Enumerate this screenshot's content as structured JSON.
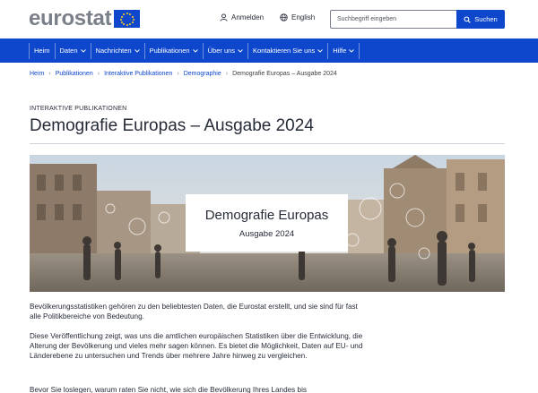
{
  "header": {
    "logo_text": "eurostat",
    "login_label": "Anmelden",
    "language_label": "English",
    "search_placeholder": "Suchbegriff eingeben",
    "search_button_label": "Suchen"
  },
  "nav": {
    "items": [
      {
        "label": "Heim"
      },
      {
        "label": "Daten"
      },
      {
        "label": "Nachrichten"
      },
      {
        "label": "Publikationen"
      },
      {
        "label": "Über uns"
      },
      {
        "label": "Kontaktieren Sie uns"
      },
      {
        "label": "Hilfe"
      }
    ]
  },
  "breadcrumb": {
    "items": [
      "Heim",
      "Publikationen",
      "Interaktive Publikationen",
      "Demographie"
    ],
    "current": "Demografie Europas – Ausgabe 2024"
  },
  "page": {
    "kicker": "INTERAKTIVE PUBLIKATIONEN",
    "title": "Demografie Europas – Ausgabe 2024"
  },
  "hero": {
    "title": "Demografie Europas",
    "subtitle": "Ausgabe 2024"
  },
  "content": {
    "paragraphs": [
      "Bevölkerungsstatistiken gehören zu den beliebtesten Daten, die Eurostat erstellt, und sie sind für fast alle Politikbereiche von Bedeutung.",
      "Diese Veröffentlichung zeigt, was uns die amtlichen europäischen Statistiken über die Entwicklung, die Alterung der Bevölkerung und vieles mehr sagen können. Es bietet die Möglichkeit, Daten auf EU- und Länderebene zu untersuchen und Trends über mehrere Jahre hinweg zu vergleichen.",
      "Bevor Sie loslegen, warum raten Sie nicht, wie sich die Bevölkerung Ihres Landes bis"
    ]
  },
  "colors": {
    "brand_blue": "#0e47cb",
    "logo_grey": "#7a7f8a",
    "flag_star": "#ffd617"
  },
  "icons": [
    "user-icon",
    "globe-icon",
    "magnifier-icon",
    "chevron-down-icon",
    "breadcrumb-chevron-icon"
  ]
}
